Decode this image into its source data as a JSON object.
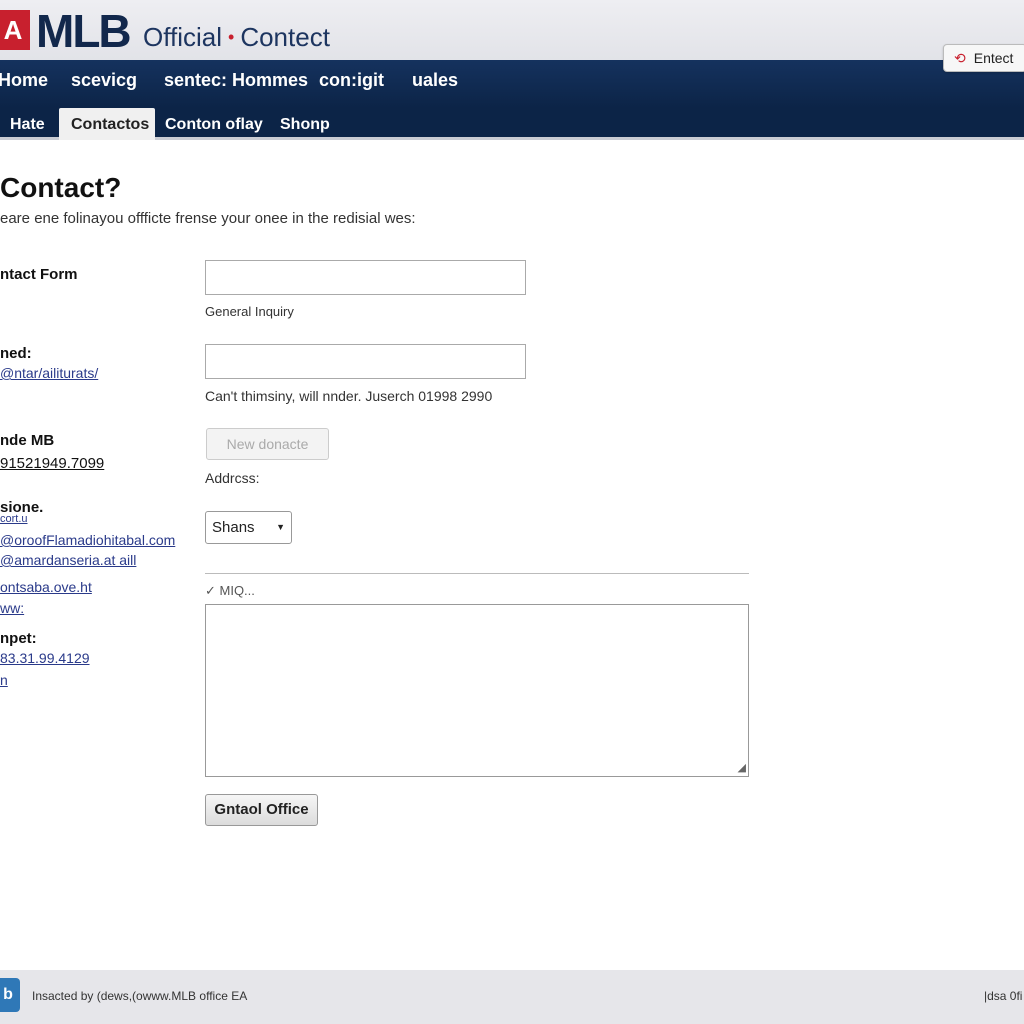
{
  "header": {
    "logo_mark": "A",
    "logo": "MLB",
    "title_left": "Official",
    "title_sep": "•",
    "title_right": "Contect",
    "enter_icon": "refresh-arrow-icon",
    "enter_label": "Entect"
  },
  "nav": {
    "items": [
      "Home",
      "scevicg",
      "sentec: Hommes",
      "con:igit",
      "uales"
    ]
  },
  "subnav": {
    "items": [
      "Hate",
      "Contactos",
      "Conton oflay",
      "Shonp"
    ],
    "active": 1
  },
  "page": {
    "title": "Contact?",
    "intro": "eare ene folinayou offficte frense your onee in the redisial wes:"
  },
  "left": {
    "contact_form": "ntact Form",
    "ned_label": "ned:",
    "ned_link": "@ntar/ailiturats/",
    "mb_label": "nde MB",
    "mb_phone": "91521949.7099",
    "sione_label": "sione.",
    "sione_link1": "cort.u",
    "sione_link2": "@oroofFlamadiohitabal.com",
    "sione_link3": "@amardanseria.at aill",
    "link4": "ontsaba.ove.ht",
    "link5": "ww:",
    "npet_label": "npet:",
    "npet_link": "83.31.99.4129",
    "npet_link2": "n"
  },
  "form": {
    "field1_value": "",
    "field1_note": "General Inquiry",
    "field2_value": "",
    "field2_note": "Can't thimsiny, will nnder. Juserch 01998 2990",
    "disabled_button": "New donacte",
    "address_label": "Addrcss:",
    "select_value": "Shans",
    "check_label": "✓ MIQ...",
    "message_value": "",
    "submit": "Gntaol Office"
  },
  "footer": {
    "icon": "app-icon",
    "text": "Insacted by (dews,(owww.MLB office EA",
    "right": "|dsa 0fi"
  },
  "colors": {
    "navy": "#0c2447",
    "brand_red": "#c8202e",
    "link": "#2a3a8a"
  }
}
